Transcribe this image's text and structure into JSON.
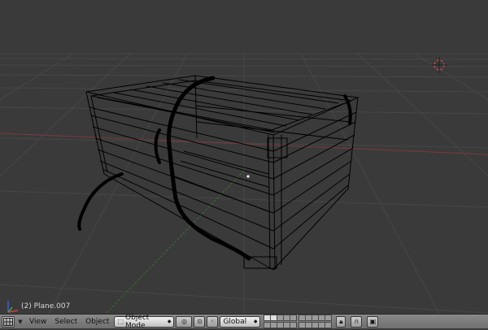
{
  "viewport": {
    "object_label": "(2) Plane.007",
    "background": "#3a3a3a",
    "grid_color": "#474747",
    "axis_x_color": "#8a3a3a",
    "axis_y_color": "#3a7a3a",
    "wire_color": "#000000"
  },
  "header": {
    "editor_type_icon": "grid-icon",
    "menu_view": "View",
    "menu_select": "Select",
    "menu_object": "Object",
    "mode_label": "Object Mode",
    "orientation_label": "Global"
  }
}
